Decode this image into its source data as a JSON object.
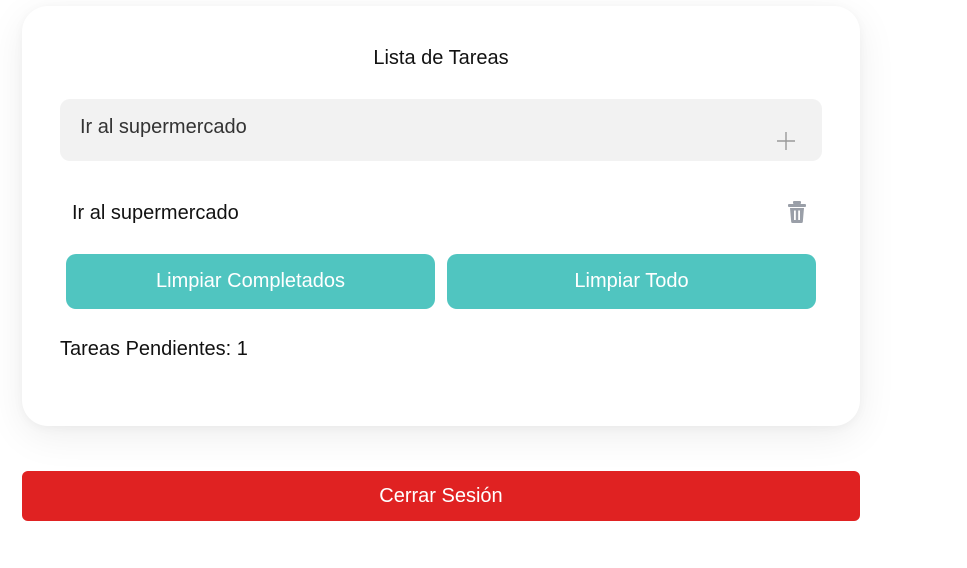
{
  "todo": {
    "title": "Lista de Tareas",
    "input_value": "Ir al supermercado",
    "add_icon": "plus-icon",
    "tasks": [
      {
        "label": "Ir al supermercado",
        "delete_icon": "trash-icon"
      }
    ],
    "clear_completed_label": "Limpiar Completados",
    "clear_all_label": "Limpiar Todo",
    "pending_text": "Tareas Pendientes: 1"
  },
  "logout_label": "Cerrar Sesión",
  "colors": {
    "accent": "#50c5c0",
    "danger": "#e02222",
    "input_bg": "#f2f2f2"
  }
}
